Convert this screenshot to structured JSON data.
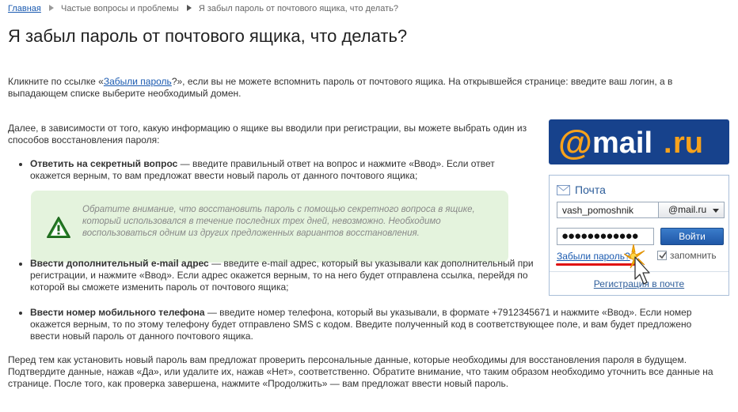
{
  "breadcrumb": {
    "home": "Главная",
    "faq": "Частые вопросы и проблемы",
    "current": "Я забыл пароль от почтового ящика, что делать?"
  },
  "page_title": "Я забыл пароль от почтового ящика, что делать?",
  "intro": {
    "before": "Кликните по ссылке «",
    "link": "Забыли пароль",
    "after": "?», если вы не можете вспомнить пароль от почтового ящика. На открывшейся странице: введите ваш логин, а в выпадающем списке выберите необходимый домен."
  },
  "main_text": "Далее, в зависимости от того, какую информацию о ящике вы вводили при регистрации, вы можете выбрать один из способов восстановления пароля:",
  "methods": [
    {
      "title": "Ответить на секретный вопрос",
      "text": " — введите правильный ответ на вопрос и нажмите «Ввод». Если ответ окажется верным, то вам предложат ввести новый пароль от данного почтового ящика;"
    },
    {
      "title": "Ввести дополнительный e-mail адрес",
      "text": " — введите e-mail адрес, который вы указывали как дополнительный при регистрации, и нажмите «Ввод». Если адрес окажется верным, то на него будет отправлена ссылка, перейдя по которой вы сможете изменить пароль от почтового ящика;"
    },
    {
      "title": "Ввести номер мобильного телефона",
      "text": " — введите номер телефона, который вы указывали, в формате +7912345671 и нажмите «Ввод». Если номер окажется верным, то по этому телефону будет отправлено SMS с кодом. Введите полученный код в соответствующее поле, и вам будет предложено ввести новый пароль от данного почтового ящика."
    }
  ],
  "notice": "Обратите внимание, что восстановить пароль с помощью секретного вопроса в ящике, который использовался в течение последних трех дней, невозможно. Необходимо воспользоваться одним из других предложенных вариантов восстановления.",
  "final_text": "Перед тем как установить новый пароль вам предложат проверить персональные данные, которые необходимы для восстановления пароля в будущем. Подтвердите данные, нажав «Да», или удалите их, нажав «Нет», соответственно. Обратите внимание, что таким образом необходимо уточнить все данные на странице. После того, как проверка завершена, нажмите «Продолжить» — вам предложат ввести новый пароль.",
  "widget": {
    "logo_at": "@",
    "logo_mail": "mail",
    "logo_dot": ".",
    "logo_ru": "ru",
    "title": "Почта",
    "login_value": "vash_pomoshnik",
    "domain": "@mail.ru",
    "password_dots": "●●●●●●●●●●●●",
    "login_button": "Войти",
    "forgot_link": "Забыли пароль?",
    "remember_label": "запомнить",
    "remember_checked": true,
    "register_link": "Регистрация в почте"
  },
  "colors": {
    "link": "#1a5ab0",
    "logo_bg": "#17428c",
    "logo_orange": "#f8a21b",
    "notice_bg": "#e4f3dd",
    "highlight_red": "#e01010"
  },
  "icons": [
    "breadcrumb-arrow-icon",
    "warning-icon",
    "envelope-icon",
    "chevron-down-icon",
    "checkmark-icon",
    "mouse-cursor-icon"
  ]
}
